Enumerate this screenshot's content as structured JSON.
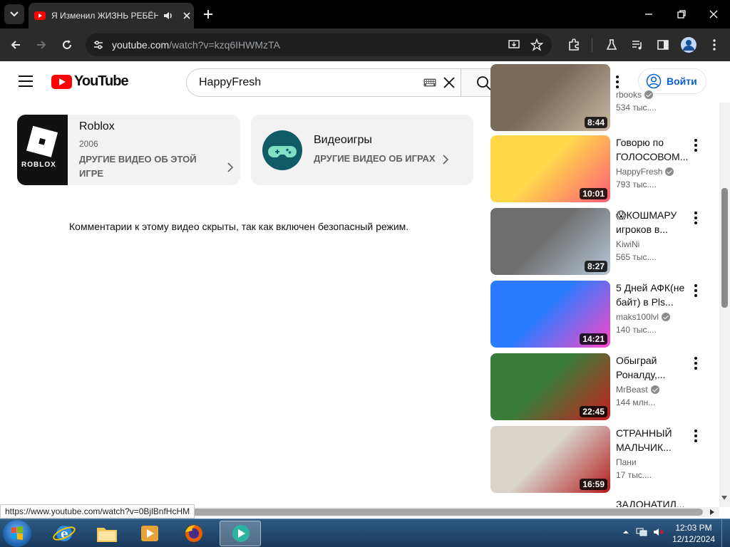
{
  "browser": {
    "tab_title": "Я Изменил ЖИЗНЬ РЕБЁНКА",
    "url_host": "youtube.com",
    "url_path": "/watch?v=kzq6IHWMzTA",
    "status_url": "https://www.youtube.com/watch?v=0BjlBnfHcHM"
  },
  "youtube": {
    "logo_text": "YouTube",
    "search_value": "HappyFresh",
    "signin_label": "Войти"
  },
  "cards": {
    "roblox": {
      "logo_text": "ROBLOX",
      "title": "Roblox",
      "year": "2006",
      "link": "ДРУГИЕ ВИДЕО ОБ ЭТОЙ ИГРЕ"
    },
    "games": {
      "title": "Видеоигры",
      "link": "ДРУГИЕ ВИДЕО ОБ ИГРАХ"
    }
  },
  "comments_note": "Комментарии к этому видео скрыты, так как включен безопасный режим.",
  "recommendations": [
    {
      "title": "",
      "channel": "rbooks",
      "views": "534 тыс....",
      "duration": "8:44",
      "verified": true,
      "colors": [
        "#7a6a5a",
        "#c9b9a3"
      ]
    },
    {
      "title": "Говорю по ГОЛОСОВОМ...",
      "channel": "HappyFresh",
      "views": "793 тыс....",
      "duration": "10:01",
      "verified": true,
      "colors": [
        "#ffd84a",
        "#ff5b7a"
      ]
    },
    {
      "title": "😱КОШМАРУ игроков в...",
      "channel": "KiwiNi",
      "views": "565 тыс....",
      "duration": "8:27",
      "verified": false,
      "colors": [
        "#6e6e6e",
        "#b8c7d6"
      ]
    },
    {
      "title": "5 Дней АФК(не байт) в Pls...",
      "channel": "maks100lvl",
      "views": "140 тыс....",
      "duration": "14:21",
      "verified": true,
      "colors": [
        "#2b7bff",
        "#ff47c8"
      ]
    },
    {
      "title": "Обыграй Роналду,...",
      "channel": "MrBeast",
      "views": "144 млн...",
      "duration": "22:45",
      "verified": true,
      "colors": [
        "#3a7d3a",
        "#c81e1e"
      ]
    },
    {
      "title": "СТРАННЫЙ МАЛЬЧИК...",
      "channel": "Пани",
      "views": "17 тыс....",
      "duration": "16:59",
      "verified": false,
      "colors": [
        "#d9d3cc",
        "#b31c1c"
      ]
    }
  ],
  "next_rec_title": "ЗАДОНАТИЛ...",
  "taskbar": {
    "time": "12:03 PM",
    "date": "12/12/2024"
  }
}
